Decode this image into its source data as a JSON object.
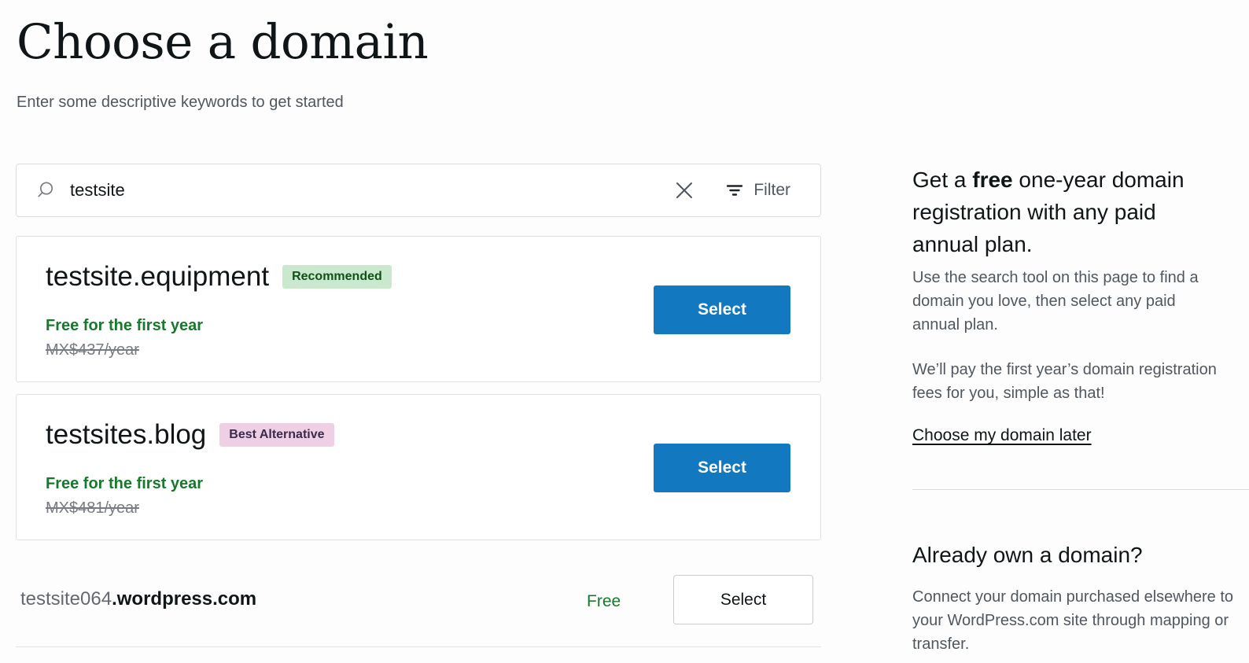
{
  "header": {
    "title": "Choose a domain",
    "subtitle": "Enter some descriptive keywords to get started"
  },
  "search": {
    "value": "testsite",
    "placeholder": "Enter some descriptive keywords to get started",
    "search_icon": "search-icon",
    "clear_icon": "close-icon",
    "filter_icon": "filter-icon",
    "filter_label": "Filter"
  },
  "results": [
    {
      "domain": "testsite.equipment",
      "badge": "Recommended",
      "badge_type": "recommended",
      "free_text": "Free for the first year",
      "price": "MX$437/year",
      "button_label": "Select"
    },
    {
      "domain": "testsites.blog",
      "badge": "Best Alternative",
      "badge_type": "alternative",
      "free_text": "Free for the first year",
      "price": "MX$481/year",
      "button_label": "Select"
    }
  ],
  "subdomain": {
    "name": "testsite064",
    "tld": ".wordpress.com",
    "price": "Free",
    "button_label": "Select"
  },
  "sidebar": {
    "heading_before": "Get a ",
    "heading_bold": "free",
    "heading_after": " one-year domain registration with any paid annual plan.",
    "paragraph_1": "Use the search tool on this page to find a domain you love, then select any paid annual plan.",
    "paragraph_2": "We’ll pay the first year’s domain registration fees for you, simple as that!",
    "link_label": "Choose my domain later",
    "heading_2": "Already own a domain?",
    "paragraph_3": "Connect your domain purchased elsewhere to your WordPress.com site through mapping or transfer."
  },
  "colors": {
    "accent_blue": "#1279c0",
    "green_text": "#17792b",
    "badge_green_bg": "#c9e8cd",
    "badge_green_text": "#124f19",
    "badge_purple_bg": "#efcfe3",
    "badge_purple_text": "#3c2a4d",
    "page_bg": "#fdfdfd"
  }
}
